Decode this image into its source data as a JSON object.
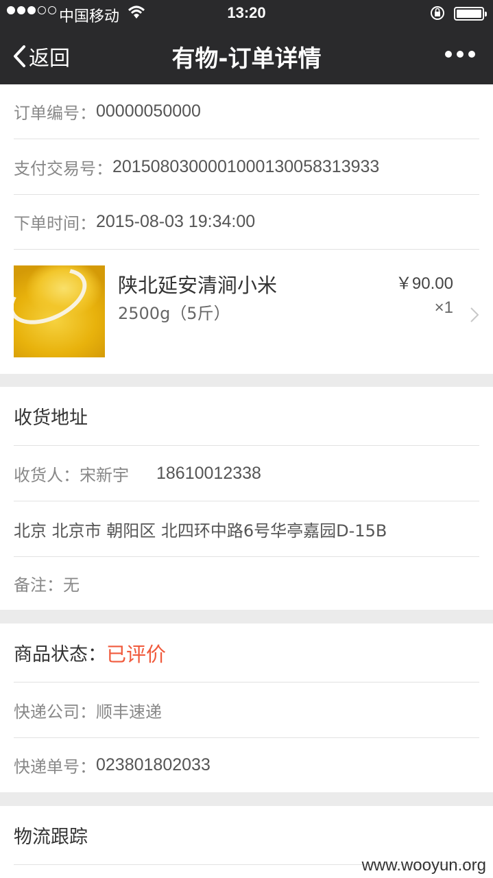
{
  "status_bar": {
    "carrier": "中国移动",
    "time": "13:20",
    "signal_icon": "signal-dots-icon",
    "wifi_icon": "wifi-icon",
    "lock_icon": "rotation-lock-icon",
    "battery_icon": "battery-icon"
  },
  "nav": {
    "back_label": "返回",
    "title": "有物-订单详情",
    "more_icon": "more-dots-icon"
  },
  "order": {
    "number_label": "订单编号：",
    "number": "00000050000",
    "payment_label": "支付交易号：",
    "payment_no": "2015080300001000130058313933",
    "time_label": "下单时间：",
    "time": "2015-08-03 19:34:00"
  },
  "product": {
    "name": "陕北延安清涧小米",
    "spec": "2500g（5斤）",
    "price": "￥90.00",
    "quantity": "×1",
    "image_icon": "millet-product-image"
  },
  "address": {
    "heading": "收货地址",
    "receiver_label": "收货人：",
    "receiver_name": "宋新宇",
    "receiver_phone": "18610012338",
    "full_address": "北京 北京市 朝阳区 北四环中路6号华亭嘉园D-15B",
    "note_label": "备注：",
    "note": "无"
  },
  "shipping": {
    "status_label": "商品状态：",
    "status": "已评价",
    "status_color": "#f05a3c",
    "company_label": "快递公司：",
    "company": "顺丰速递",
    "tracking_label": "快递单号：",
    "tracking_no": "023801802033"
  },
  "logistics": {
    "heading": "物流跟踪"
  },
  "watermark": "www.wooyun.org"
}
